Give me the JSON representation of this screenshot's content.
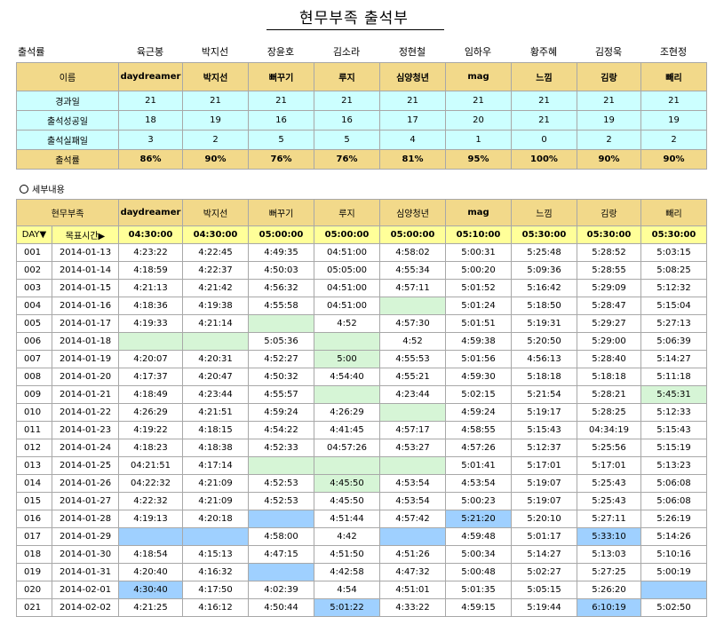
{
  "title": "현무부족 출석부",
  "attendance_rate_label": "출석률",
  "real_names": [
    "육근봉",
    "박지선",
    "장윤호",
    "김소라",
    "정현철",
    "임하우",
    "황주혜",
    "김정욱",
    "조현정"
  ],
  "summary": {
    "name_label": "이름",
    "nicknames": [
      "daydreamer",
      "박지선",
      "뻐꾸기",
      "루지",
      "심양청년",
      "mag",
      "느낌",
      "김랑",
      "빼리"
    ],
    "rows": [
      {
        "label": "경과일",
        "values": [
          "21",
          "21",
          "21",
          "21",
          "21",
          "21",
          "21",
          "21",
          "21"
        ]
      },
      {
        "label": "출석성공일",
        "values": [
          "18",
          "19",
          "16",
          "16",
          "17",
          "20",
          "21",
          "19",
          "19"
        ]
      },
      {
        "label": "출석실패일",
        "values": [
          "3",
          "2",
          "5",
          "5",
          "4",
          "1",
          "0",
          "2",
          "2"
        ]
      }
    ],
    "rate_label": "출석률",
    "rates": [
      "86%",
      "90%",
      "76%",
      "76%",
      "81%",
      "95%",
      "100%",
      "90%",
      "90%"
    ]
  },
  "detail_label": "세부내용",
  "detail": {
    "tribe_label": "현무부족",
    "day_label": "DAY▼",
    "target_label": "목표시간▶",
    "targets": [
      "04:30:00",
      "04:30:00",
      "05:00:00",
      "05:00:00",
      "05:00:00",
      "05:10:00",
      "05:30:00",
      "05:30:00",
      "05:30:00"
    ],
    "rows": [
      {
        "day": "001",
        "date": "2014-01-13",
        "times": [
          "4:23:22",
          "4:22:45",
          "4:49:35",
          "04:51:00",
          "4:58:02",
          "5:00:31",
          "5:25:48",
          "5:28:52",
          "5:03:15"
        ]
      },
      {
        "day": "002",
        "date": "2014-01-14",
        "times": [
          "4:18:59",
          "4:22:37",
          "4:50:03",
          "05:05:00",
          "4:55:34",
          "5:00:20",
          "5:09:36",
          "5:28:55",
          "5:08:25"
        ]
      },
      {
        "day": "003",
        "date": "2014-01-15",
        "times": [
          "4:21:13",
          "4:21:42",
          "4:56:32",
          "04:51:00",
          "4:57:11",
          "5:01:52",
          "5:16:42",
          "5:29:09",
          "5:12:32"
        ]
      },
      {
        "day": "004",
        "date": "2014-01-16",
        "times": [
          "4:18:36",
          "4:19:38",
          "4:55:58",
          "04:51:00",
          "",
          "5:01:24",
          "5:18:50",
          "5:28:47",
          "5:15:04"
        ]
      },
      {
        "day": "005",
        "date": "2014-01-17",
        "times": [
          "4:19:33",
          "4:21:14",
          "",
          "4:52",
          "4:57:30",
          "5:01:51",
          "5:19:31",
          "5:29:27",
          "5:27:13"
        ]
      },
      {
        "day": "006",
        "date": "2014-01-18",
        "times": [
          "",
          "",
          "5:05:36",
          "",
          "4:52",
          "4:59:38",
          "5:20:50",
          "5:29:00",
          "5:06:39"
        ]
      },
      {
        "day": "007",
        "date": "2014-01-19",
        "times": [
          "4:20:07",
          "4:20:31",
          "4:52:27",
          "5:00",
          "4:55:53",
          "5:01:56",
          "4:56:13",
          "5:28:40",
          "5:14:27"
        ]
      },
      {
        "day": "008",
        "date": "2014-01-20",
        "times": [
          "4:17:37",
          "4:20:47",
          "4:50:32",
          "4:54:40",
          "4:55:21",
          "4:59:30",
          "5:18:18",
          "5:18:18",
          "5:11:18"
        ]
      },
      {
        "day": "009",
        "date": "2014-01-21",
        "times": [
          "4:18:49",
          "4:23:44",
          "4:55:57",
          "",
          "4:23:44",
          "5:02:15",
          "5:21:54",
          "5:28:21",
          "5:45:31"
        ]
      },
      {
        "day": "010",
        "date": "2014-01-22",
        "times": [
          "4:26:29",
          "4:21:51",
          "4:59:24",
          "4:26:29",
          "",
          "4:59:24",
          "5:19:17",
          "5:28:25",
          "5:12:33"
        ]
      },
      {
        "day": "011",
        "date": "2014-01-23",
        "times": [
          "4:19:22",
          "4:18:15",
          "4:54:22",
          "4:41:45",
          "4:57:17",
          "4:58:55",
          "5:15:43",
          "04:34:19",
          "5:15:43"
        ]
      },
      {
        "day": "012",
        "date": "2014-01-24",
        "times": [
          "4:18:23",
          "4:18:38",
          "4:52:33",
          "04:57:26",
          "4:53:27",
          "4:57:26",
          "5:12:37",
          "5:25:56",
          "5:15:19"
        ]
      },
      {
        "day": "013",
        "date": "2014-01-25",
        "times": [
          "04:21:51",
          "4:17:14",
          "",
          "",
          "",
          "5:01:41",
          "5:17:01",
          "5:17:01",
          "5:13:23"
        ]
      },
      {
        "day": "014",
        "date": "2014-01-26",
        "times": [
          "04:22:32",
          "4:21:09",
          "4:52:53",
          "4:45:50",
          "4:53:54",
          "4:53:54",
          "5:19:07",
          "5:25:43",
          "5:06:08"
        ]
      },
      {
        "day": "015",
        "date": "2014-01-27",
        "times": [
          "4:22:32",
          "4:21:09",
          "4:52:53",
          "4:45:50",
          "4:53:54",
          "5:00:23",
          "5:19:07",
          "5:25:43",
          "5:06:08"
        ]
      },
      {
        "day": "016",
        "date": "2014-01-28",
        "times": [
          "4:19:13",
          "4:20:18",
          "",
          "4:51:44",
          "4:57:42",
          "5:21:20",
          "5:20:10",
          "5:27:11",
          "5:26:19"
        ]
      },
      {
        "day": "017",
        "date": "2014-01-29",
        "times": [
          "",
          "",
          "4:58:00",
          "4:42",
          "",
          "4:59:48",
          "5:01:17",
          "5:33:10",
          "5:14:26"
        ]
      },
      {
        "day": "018",
        "date": "2014-01-30",
        "times": [
          "4:18:54",
          "4:15:13",
          "4:47:15",
          "4:51:50",
          "4:51:26",
          "5:00:34",
          "5:14:27",
          "5:13:03",
          "5:10:16"
        ]
      },
      {
        "day": "019",
        "date": "2014-01-31",
        "times": [
          "4:20:40",
          "4:16:32",
          "",
          "4:42:58",
          "4:47:32",
          "5:00:48",
          "5:02:27",
          "5:27:25",
          "5:00:19"
        ]
      },
      {
        "day": "020",
        "date": "2014-02-01",
        "times": [
          "4:30:40",
          "4:17:50",
          "4:02:39",
          "4:54",
          "4:51:01",
          "5:01:35",
          "5:05:15",
          "5:26:20",
          ""
        ]
      },
      {
        "day": "021",
        "date": "2014-02-02",
        "times": [
          "4:21:25",
          "4:16:12",
          "4:50:44",
          "5:01:22",
          "4:33:22",
          "4:59:15",
          "5:19:44",
          "6:10:19",
          "5:02:50"
        ]
      }
    ],
    "highlights": {
      "green": [
        "4-4",
        "5-2",
        "6-0",
        "6-1",
        "6-3",
        "7-3",
        "9-3",
        "9-8",
        "10-4",
        "13-2",
        "13-3",
        "13-4",
        "14-3"
      ],
      "blue": [
        "16-2",
        "16-5",
        "17-0",
        "17-1",
        "17-4",
        "17-7",
        "19-2",
        "20-0",
        "20-8",
        "21-3",
        "21-7"
      ]
    }
  }
}
